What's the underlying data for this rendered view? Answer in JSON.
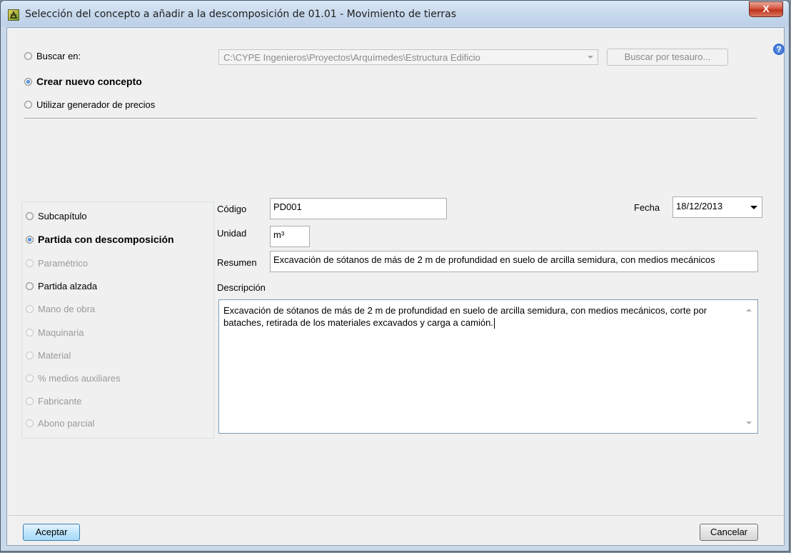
{
  "window": {
    "title": "Selección del concepto a añadir a la descomposición de 01.01 - Movimiento de tierras",
    "close_label": "X"
  },
  "source_options": [
    {
      "label": "Buscar en:",
      "checked": false,
      "bold": false
    },
    {
      "label": "Crear nuevo concepto",
      "checked": true,
      "bold": true
    },
    {
      "label": "Utilizar generador de precios",
      "checked": false,
      "bold": false
    }
  ],
  "path_combo": {
    "value": "C:\\CYPE Ingenieros\\Proyectos\\Arquímedes\\Estructura Edificio"
  },
  "thesaurus_button": "Buscar por tesauro...",
  "help_icon": "?",
  "type_options": [
    {
      "label": "Subcapítulo",
      "checked": false,
      "enabled": true,
      "bold": false
    },
    {
      "label": "Partida con descomposición",
      "checked": true,
      "enabled": true,
      "bold": true
    },
    {
      "label": "Paramétrico",
      "checked": false,
      "enabled": false,
      "bold": false
    },
    {
      "label": "Partida alzada",
      "checked": false,
      "enabled": true,
      "bold": false
    },
    {
      "label": "Mano de obra",
      "checked": false,
      "enabled": false,
      "bold": false
    },
    {
      "label": "Maquinaria",
      "checked": false,
      "enabled": false,
      "bold": false
    },
    {
      "label": "Material",
      "checked": false,
      "enabled": false,
      "bold": false
    },
    {
      "label": "% medios auxiliares",
      "checked": false,
      "enabled": false,
      "bold": false
    },
    {
      "label": "Fabricante",
      "checked": false,
      "enabled": false,
      "bold": false
    },
    {
      "label": "Abono parcial",
      "checked": false,
      "enabled": false,
      "bold": false
    }
  ],
  "form": {
    "codigo_label": "Código",
    "codigo_value": "PD001",
    "fecha_label": "Fecha",
    "fecha_value": "18/12/2013",
    "unidad_label": "Unidad",
    "unidad_value": "m³",
    "resumen_label": "Resumen",
    "resumen_value": "Excavación de sótanos de más de 2 m de profundidad en suelo de arcilla semidura, con medios mecánicos",
    "descripcion_label": "Descripción",
    "descripcion_value": "Excavación de sótanos de más de 2 m de profundidad en suelo de arcilla semidura, con medios mecánicos, corte por bataches, retirada de los materiales excavados y carga a camión."
  },
  "footer": {
    "accept": "Aceptar",
    "cancel": "Cancelar"
  }
}
